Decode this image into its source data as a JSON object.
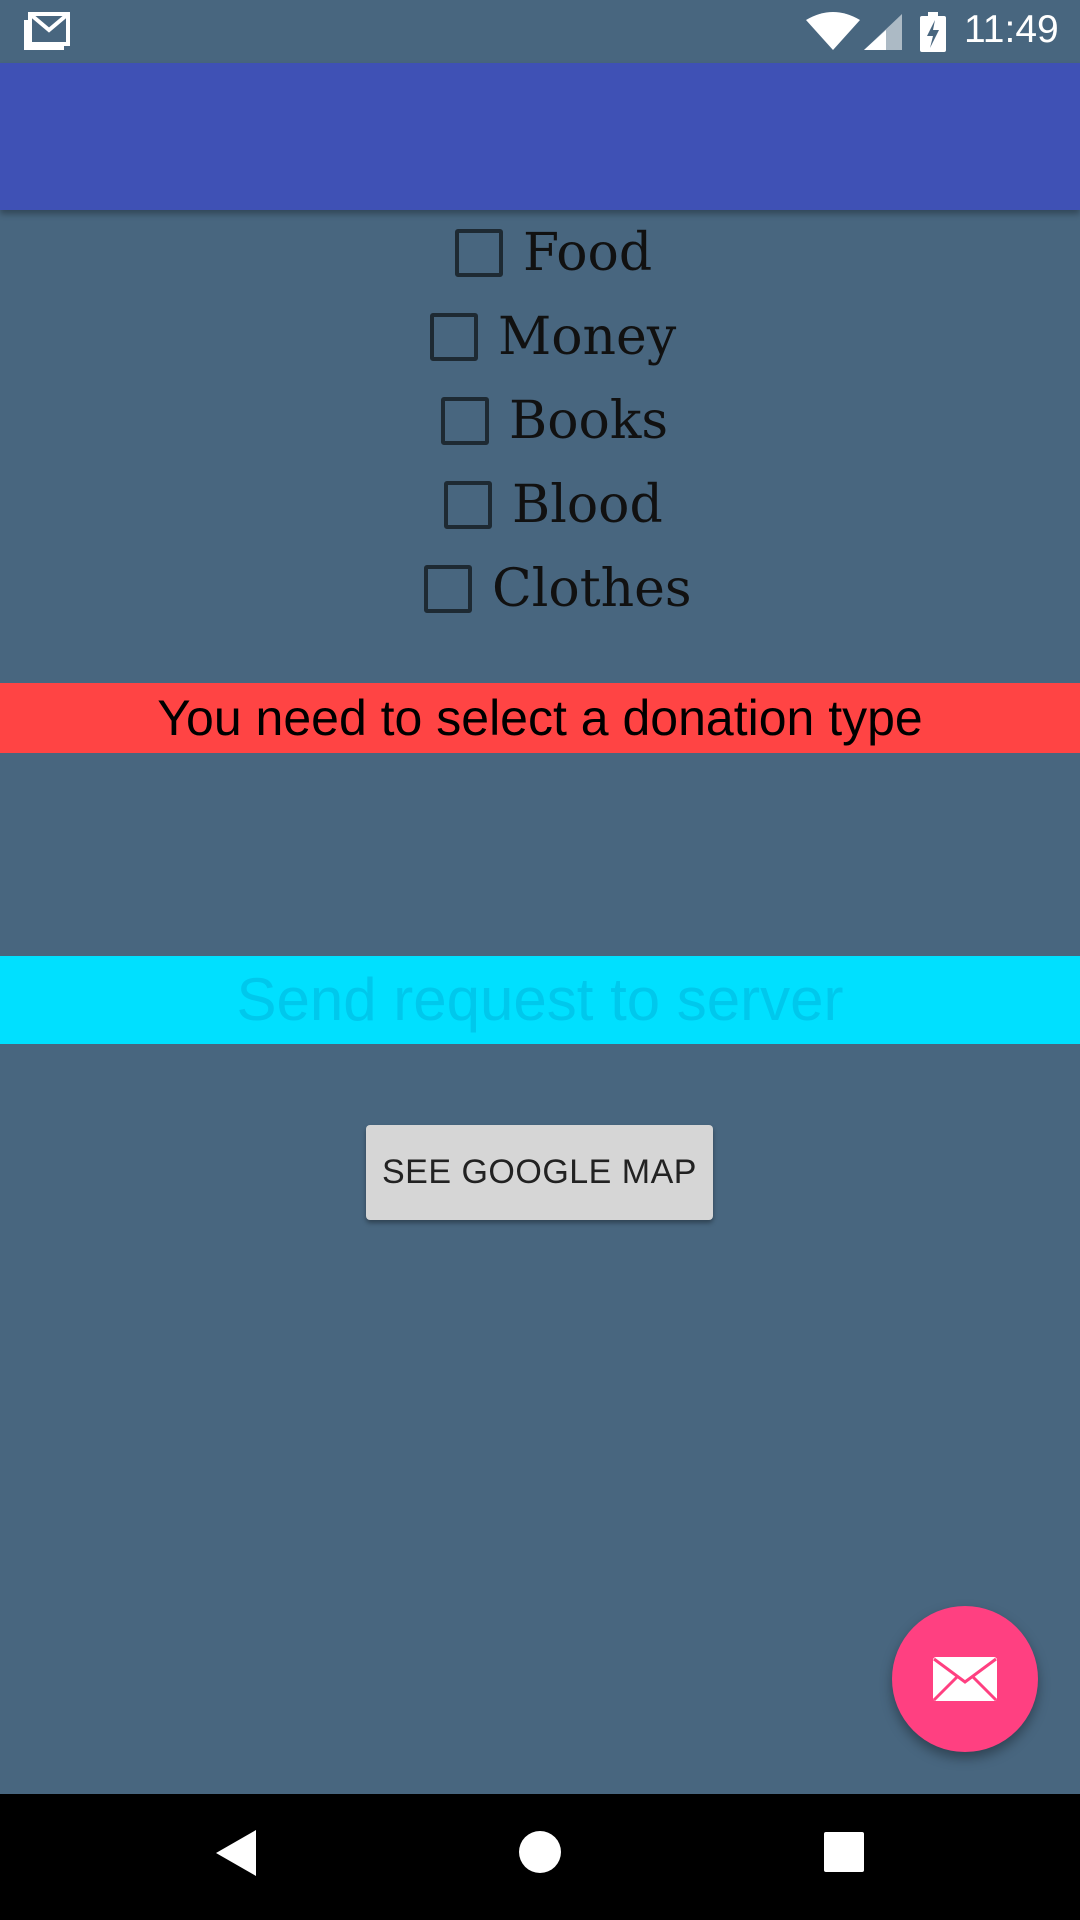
{
  "status_bar": {
    "time": "11:49",
    "icons": [
      "gmail-icon",
      "wifi-icon",
      "signal-icon",
      "battery-charging-icon"
    ]
  },
  "donation_types": [
    {
      "label": "Food",
      "checked": false
    },
    {
      "label": "Money",
      "checked": false
    },
    {
      "label": "Books",
      "checked": false
    },
    {
      "label": "Blood",
      "checked": false
    },
    {
      "label": "Clothes",
      "checked": false
    }
  ],
  "error_message": "You need to select a donation type",
  "send_request": "Send request to server",
  "map_button_label": "SEE GOOGLE MAP",
  "fab_icon": "mail-icon",
  "nav_bar": {
    "icons": [
      "back-icon",
      "home-icon",
      "recents-icon"
    ]
  },
  "colors": {
    "background": "#48667F",
    "app_bar": "#3F51B5",
    "error_banner": "#FF4444",
    "send_bar": "#00E0FF",
    "fab": "#FF4081"
  }
}
